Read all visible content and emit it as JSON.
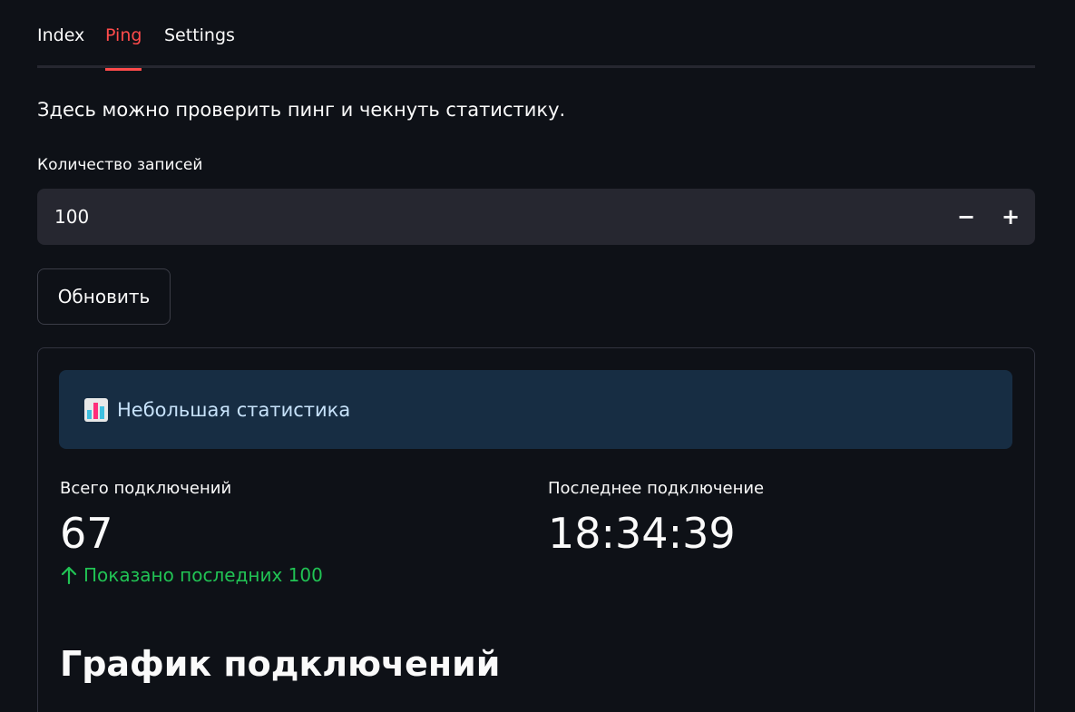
{
  "tabs": [
    {
      "label": "Index",
      "active": false
    },
    {
      "label": "Ping",
      "active": true
    },
    {
      "label": "Settings",
      "active": false
    }
  ],
  "intro_text": "Здесь можно проверить пинг и чекнуть статистику.",
  "records_input": {
    "label": "Количество записей",
    "value": "100",
    "minus_label": "−",
    "plus_label": "+"
  },
  "refresh_button": {
    "label": "Обновить"
  },
  "stats": {
    "info_title": "Небольшая статистика",
    "info_icon": "bar-chart-icon",
    "total_connections": {
      "label": "Всего подключений",
      "value": "67",
      "delta": "Показано последних 100"
    },
    "last_connection": {
      "label": "Последнее подключение",
      "value": "18:34:39"
    },
    "chart_section_title": "График подключений"
  },
  "colors": {
    "background": "#0e1117",
    "accent": "#ff4b4b",
    "info_bg": "#172d43",
    "delta_green": "#21c354"
  }
}
